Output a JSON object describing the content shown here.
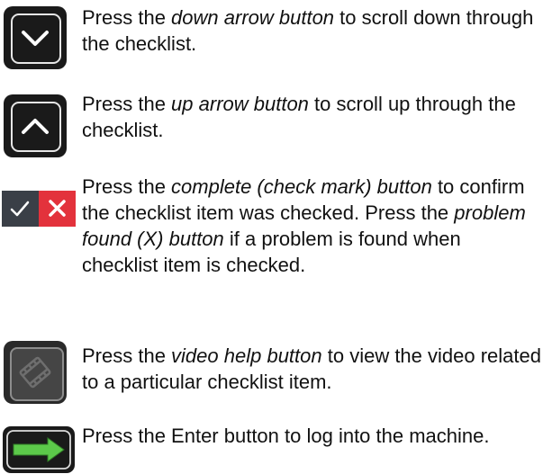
{
  "entries": [
    {
      "icon": "down-arrow-icon",
      "pre": "Press the ",
      "emphasis": "down arrow button",
      "post": " to scroll down through the checklist."
    },
    {
      "icon": "up-arrow-icon",
      "pre": "Press the ",
      "emphasis": "up arrow button",
      "post": " to scroll up through the checklist."
    },
    {
      "icon": "check-x-pair-icon",
      "pre": "Press the ",
      "emphasis": "complete (check mark) button",
      "post": " to confirm the checklist item was checked. Press the ",
      "emphasis2": "problem found (X) button",
      "post2": " if a problem is found when checklist item is checked."
    },
    {
      "icon": "video-help-icon",
      "pre": "Press the ",
      "emphasis": "video help button",
      "post": " to view the video related to a particular checklist item."
    },
    {
      "icon": "enter-arrow-icon",
      "text": "Press the Enter button to log into the machine."
    }
  ],
  "colors": {
    "button_dark": "#1a1a1a",
    "check_bg": "#3a3f47",
    "x_bg": "#e3323c",
    "enter_green": "#5cc94a"
  }
}
